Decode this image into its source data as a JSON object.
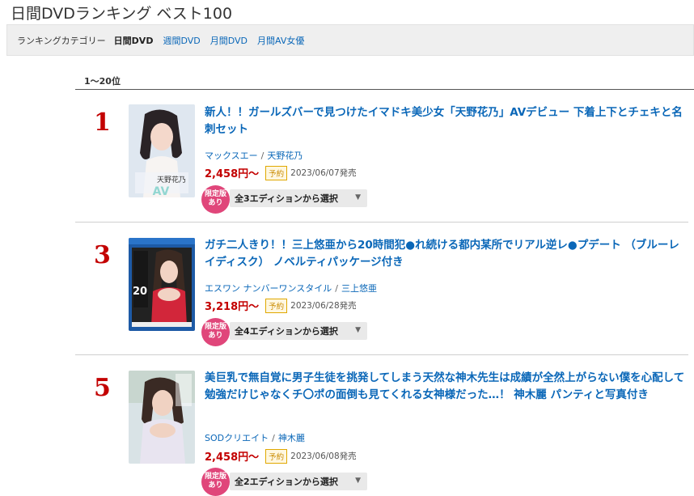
{
  "page_title": "日間DVDランキング ベスト100",
  "category_bar": {
    "label": "ランキングカテゴリー",
    "items": [
      {
        "label": "日間DVD",
        "active": true
      },
      {
        "label": "週間DVD",
        "active": false
      },
      {
        "label": "月間DVD",
        "active": false
      },
      {
        "label": "月間AV女優",
        "active": false
      }
    ]
  },
  "range_label": "1〜20位",
  "items": [
    {
      "rank": "1",
      "title": "新人！！ガールズバーで見つけたイマドキ美少女「天野花乃」AVデビュー 下着上下とチェキと名刺セット",
      "maker": "マックスエー",
      "actress": "天野花乃",
      "price": "2,458円〜",
      "badge": "予約",
      "date": "2023/06/07発売",
      "limited": "限定版あり",
      "edition": "全3エディションから選択",
      "cover_text": "天野花乃"
    },
    {
      "rank": "3",
      "title": "ガチ二人きり！！三上悠亜から20時間犯●れ続ける都内某所でリアル逆レ●プデート （ブルーレイディスク） ノベルティパッケージ付き",
      "maker": "エスワン ナンバーワンスタイル",
      "actress": "三上悠亜",
      "price": "3,218円〜",
      "badge": "予約",
      "date": "2023/06/28発売",
      "limited": "限定版あり",
      "edition": "全4エディションから選択",
      "cover_text": "20"
    },
    {
      "rank": "5",
      "title": "美巨乳で無自覚に男子生徒を挑発してしまう天然な神木先生は成績が全然上がらない僕を心配して勉強だけじゃなくチ〇ポの面倒も見てくれる女神様だった…！ 神木麗 パンティと写真付き",
      "maker": "SODクリエイト",
      "actress": "神木麗",
      "price": "2,458円〜",
      "badge": "予約",
      "date": "2023/06/08発売",
      "limited": "限定版あり",
      "edition": "全2エディションから選択"
    }
  ],
  "caret_icon": "▼"
}
